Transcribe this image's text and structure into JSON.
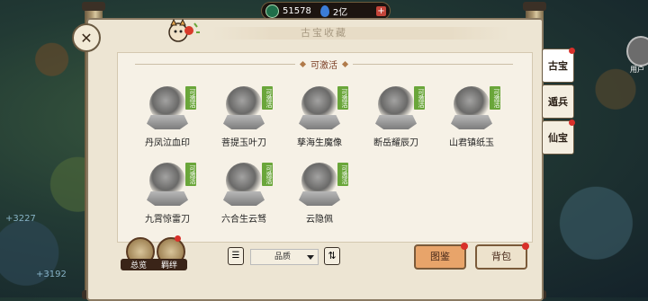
{
  "topbar": {
    "coins": "51578",
    "gems": "2亿"
  },
  "header": {
    "title": "古宝收藏"
  },
  "section": {
    "title": "可激活"
  },
  "items": [
    {
      "name": "丹凤泣血印",
      "badge": "可激活"
    },
    {
      "name": "菩提玉叶刀",
      "badge": "可激活"
    },
    {
      "name": "孳海生魔像",
      "badge": "可激活"
    },
    {
      "name": "断岳耀辰刀",
      "badge": "可激活"
    },
    {
      "name": "山君镇纸玉",
      "badge": "可激活"
    },
    {
      "name": "九霄惊雷刀",
      "badge": "可激活"
    },
    {
      "name": "六合生云驽",
      "badge": "可激活"
    },
    {
      "name": "云隐佩",
      "badge": "可激活"
    }
  ],
  "tabs": [
    {
      "label": "古宝",
      "active": true
    },
    {
      "label": "遁兵",
      "active": false
    },
    {
      "label": "仙宝",
      "active": false
    }
  ],
  "bottom": {
    "overview_label": "总览",
    "bond_label": "羁绊",
    "filter_label": "品质",
    "primary_button": "图鉴",
    "secondary_button": "背包"
  },
  "background": {
    "user_label": "用户"
  }
}
